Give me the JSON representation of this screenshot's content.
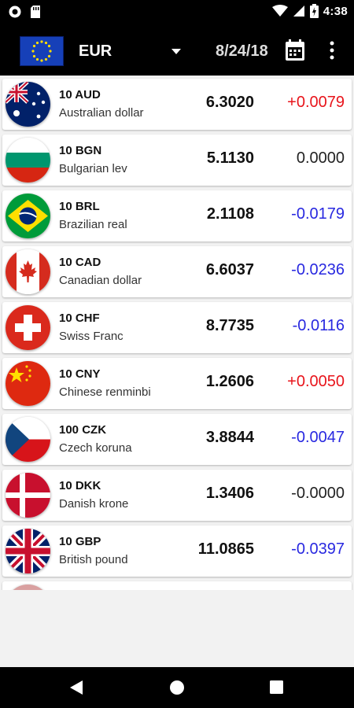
{
  "statusbar": {
    "time": "4:38",
    "icons": [
      "circle-notification-icon",
      "sd-card-icon",
      "wifi-icon",
      "signal-icon",
      "battery-charging-icon"
    ]
  },
  "appbar": {
    "base_flag": "eu-flag",
    "base_currency": "EUR",
    "date": "8/24/18",
    "calendar_icon": "calendar-icon",
    "more_icon": "more-vertical-icon",
    "dropdown_icon": "dropdown-arrow-icon"
  },
  "colors": {
    "positive": "#e8141b",
    "negative": "#2828e0",
    "neutral": "#222222"
  },
  "rates": [
    {
      "code": "10 AUD",
      "name": "Australian dollar",
      "rate": "6.3020",
      "change": "+0.0079",
      "trend": "up",
      "flag": "australia-flag"
    },
    {
      "code": "10 BGN",
      "name": "Bulgarian lev",
      "rate": "5.1130",
      "change": "0.0000",
      "trend": "flat",
      "flag": "bulgaria-flag"
    },
    {
      "code": "10 BRL",
      "name": "Brazilian real",
      "rate": "2.1108",
      "change": "-0.0179",
      "trend": "down",
      "flag": "brazil-flag"
    },
    {
      "code": "10 CAD",
      "name": "Canadian dollar",
      "rate": "6.6037",
      "change": "-0.0236",
      "trend": "down",
      "flag": "canada-flag"
    },
    {
      "code": "10 CHF",
      "name": "Swiss Franc",
      "rate": "8.7735",
      "change": "-0.0116",
      "trend": "down",
      "flag": "switzerland-flag"
    },
    {
      "code": "10 CNY",
      "name": "Chinese renminbi",
      "rate": "1.2606",
      "change": "+0.0050",
      "trend": "up",
      "flag": "china-flag"
    },
    {
      "code": "100 CZK",
      "name": "Czech koruna",
      "rate": "3.8844",
      "change": "-0.0047",
      "trend": "down",
      "flag": "czech-flag"
    },
    {
      "code": "10 DKK",
      "name": "Danish krone",
      "rate": "1.3406",
      "change": "-0.0000",
      "trend": "flat",
      "flag": "denmark-flag"
    },
    {
      "code": "10 GBP",
      "name": "British pound",
      "rate": "11.0865",
      "change": "-0.0397",
      "trend": "down",
      "flag": "uk-flag"
    }
  ],
  "navbar": {
    "back": "back-icon",
    "home": "home-icon",
    "recents": "recents-icon"
  }
}
